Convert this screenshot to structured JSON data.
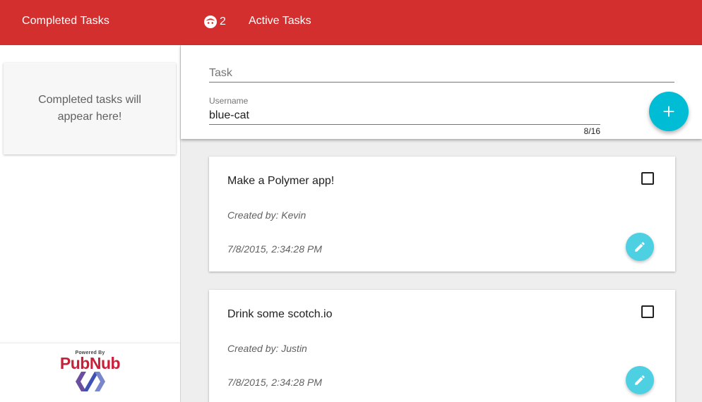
{
  "header": {
    "left_title": "Completed Tasks",
    "user_icon": "user-avatar-icon",
    "user_count": "2",
    "right_title": "Active Tasks",
    "bg_color": "#d32f2f"
  },
  "drawer": {
    "empty_message": "Completed tasks will appear here!",
    "powered_by": "Powered By",
    "brand": "PubNub"
  },
  "form": {
    "task_placeholder": "Task",
    "task_value": "",
    "username_label": "Username",
    "username_value": "blue-cat",
    "char_counter": "8/16",
    "add_icon": "plus-icon",
    "accent_color": "#00bcd4"
  },
  "tasks": [
    {
      "title": "Make a Polymer app!",
      "created_by": "Created by:  Kevin",
      "timestamp": "7/8/2015, 2:34:28 PM",
      "done": false
    },
    {
      "title": "Drink some scotch.io",
      "created_by": "Created by:  Justin",
      "timestamp": "7/8/2015, 2:34:28 PM",
      "done": false
    }
  ]
}
